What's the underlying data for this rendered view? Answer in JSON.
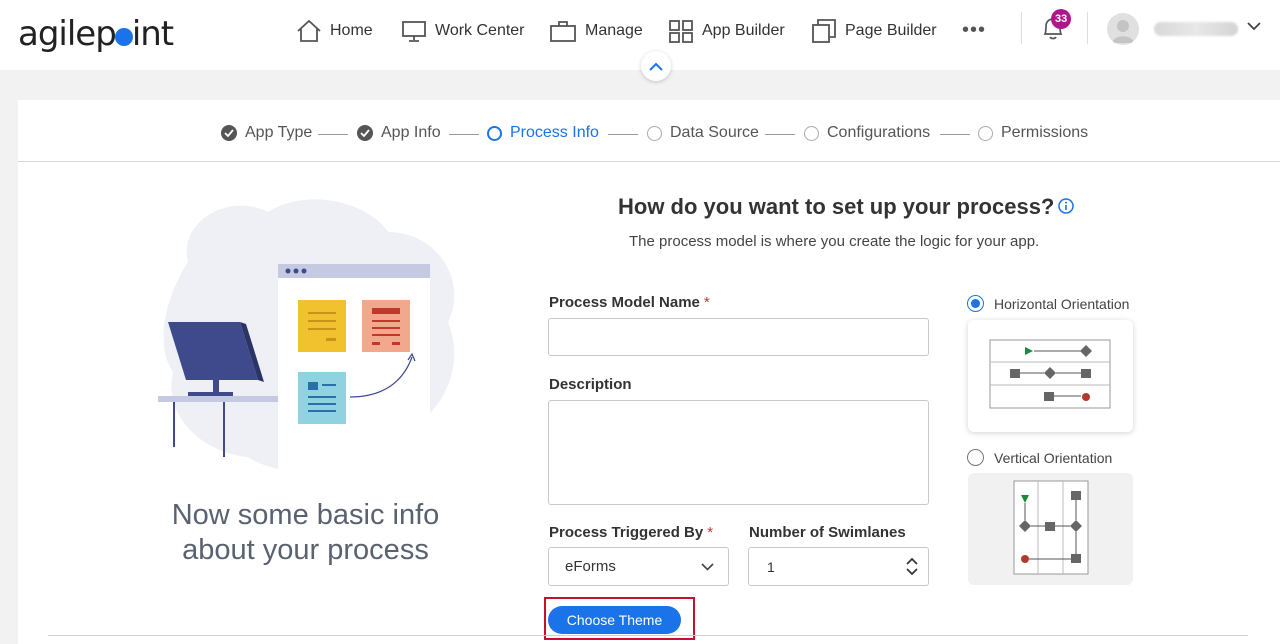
{
  "header": {
    "logo_text_a": "agilep",
    "logo_text_b": "int",
    "nav": [
      {
        "label": "Home"
      },
      {
        "label": "Work Center"
      },
      {
        "label": "Manage"
      },
      {
        "label": "App Builder"
      },
      {
        "label": "Page Builder"
      }
    ],
    "more": "•••",
    "notification_count": "33"
  },
  "steps": [
    {
      "label": "App Type",
      "state": "done"
    },
    {
      "label": "App Info",
      "state": "done"
    },
    {
      "label": "Process Info",
      "state": "active"
    },
    {
      "label": "Data Source",
      "state": "pending"
    },
    {
      "label": "Configurations",
      "state": "pending"
    },
    {
      "label": "Permissions",
      "state": "pending"
    }
  ],
  "left": {
    "title_line1": "Now some basic info",
    "title_line2": "about your process"
  },
  "form": {
    "title": "How do you want to set up your process?",
    "subtitle": "The process model is where you create the logic for your app.",
    "process_model_name_label": "Process Model Name",
    "required_mark": "*",
    "process_model_name_value": "",
    "description_label": "Description",
    "description_value": "",
    "triggered_by_label": "Process Triggered By",
    "triggered_by_value": "eForms",
    "swimlanes_label": "Number of Swimlanes",
    "swimlanes_value": "1",
    "choose_theme": "Choose Theme"
  },
  "orientation": {
    "horizontal_label": "Horizontal Orientation",
    "vertical_label": "Vertical Orientation",
    "selected": "horizontal"
  },
  "colors": {
    "accent": "#1a73e8",
    "badge": "#b0168a",
    "highlight_frame": "#c8102e"
  }
}
